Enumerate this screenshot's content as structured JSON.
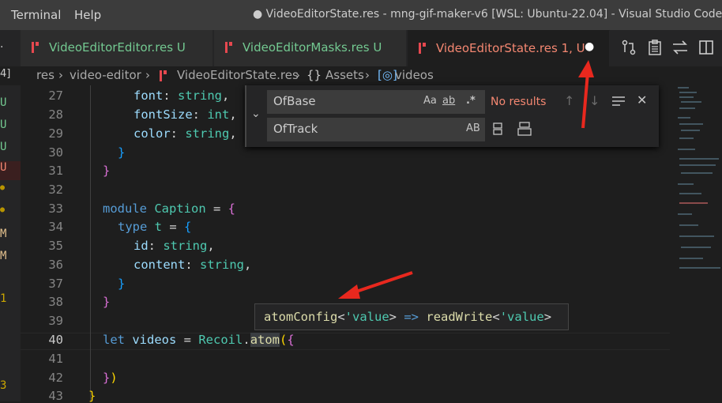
{
  "menu": {
    "terminal": "Terminal",
    "help": "Help"
  },
  "window_title": "● VideoEditorState.res - mng-gif-maker-v6 [WSL: Ubuntu-22.04] - Visual Studio Code",
  "tabs": [
    {
      "label": "VideoEditorEditor.res",
      "status": "U"
    },
    {
      "label": "VideoEditorMasks.res",
      "status": "U"
    },
    {
      "label": "VideoEditorState.res",
      "status": "1, U",
      "dirty": "●"
    }
  ],
  "breadcrumb": {
    "seg1": "res",
    "seg2": "video-editor",
    "seg3": "VideoEditorState.res",
    "seg4": "Assets",
    "seg5": "videos"
  },
  "gutter_markers": [
    "4]",
    "U",
    "U",
    "U",
    "U",
    "●",
    "●",
    "M",
    "M",
    "1",
    "3"
  ],
  "find": {
    "find_value": "OfBase",
    "replace_value": "OfTrack",
    "no_results": "No results",
    "opt_case": "Aa",
    "opt_word": "ab",
    "opt_regex": ".*",
    "opt_preserve_case": "AB"
  },
  "lines": {
    "n27": "27",
    "n28": "28",
    "n29": "29",
    "n30": "30",
    "n31": "31",
    "n32": "32",
    "n33": "33",
    "n34": "34",
    "n35": "35",
    "n36": "36",
    "n37": "37",
    "n38": "38",
    "n39": "39",
    "n40": "40",
    "n41": "41",
    "n42": "42",
    "n43": "43"
  },
  "code": {
    "l27_prop": "font",
    "l27_type": "string",
    "l28_prop": "fontSize",
    "l28_type": "int",
    "l29_prop": "color",
    "l29_type": "string",
    "l33_kw": "module",
    "l33_name": "Caption",
    "l34_kw": "type",
    "l34_name": "t",
    "l35_prop": "id",
    "l35_type": "string",
    "l36_prop": "content",
    "l36_type": "string",
    "l40_kw": "let",
    "l40_name": "videos",
    "l40_mod": "Recoil",
    "l40_fn": "atom"
  },
  "hover": {
    "fn": "atomConfig",
    "tparam": "'value",
    "arrow": "=>",
    "ret": "readWrite",
    "tparam2": "'value"
  }
}
